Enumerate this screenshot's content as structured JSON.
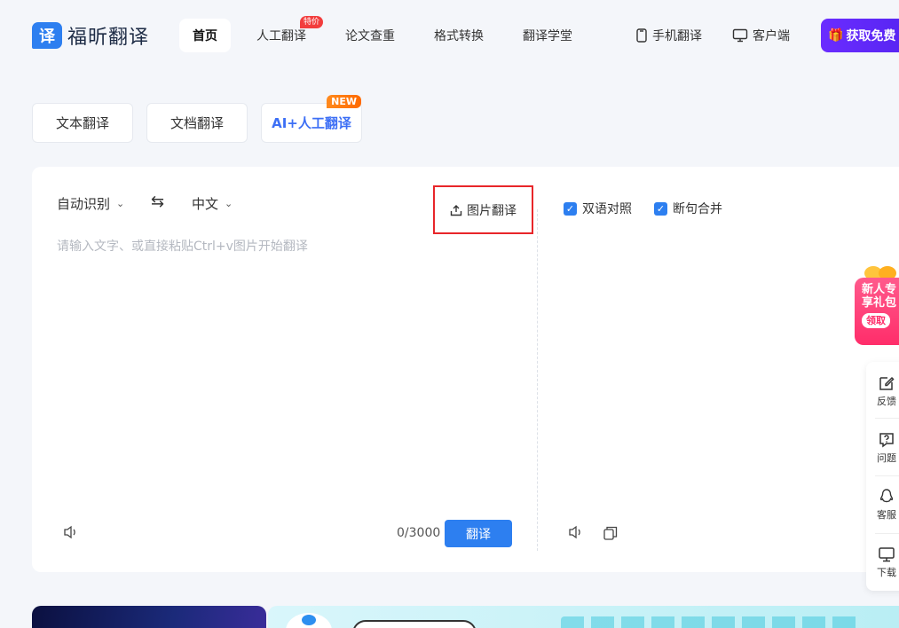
{
  "brand": {
    "name": "福昕翻译",
    "logo_char": "译"
  },
  "nav": {
    "items": [
      {
        "label": "首页",
        "active": true
      },
      {
        "label": "人工翻译",
        "badge": "特价"
      },
      {
        "label": "论文查重"
      },
      {
        "label": "格式转换"
      },
      {
        "label": "翻译学堂"
      }
    ]
  },
  "header_right": {
    "mobile": "手机翻译",
    "desktop": "客户端",
    "cta": "获取免费"
  },
  "mode_tabs": [
    {
      "label": "文本翻译"
    },
    {
      "label": "文档翻译"
    },
    {
      "label": "AI+人工翻译",
      "badge": "NEW"
    }
  ],
  "translator": {
    "source_lang": "自动识别",
    "target_lang": "中文",
    "image_translate": "图片翻译",
    "placeholder": "请输入文字、或直接粘贴Ctrl+v图片开始翻译",
    "counter": "0/3000",
    "translate_button": "翻译",
    "options": [
      {
        "label": "双语对照",
        "checked": true
      },
      {
        "label": "断句合并",
        "checked": true
      }
    ]
  },
  "promo": {
    "line1": "新人专",
    "line2": "享礼包",
    "claim": "领取"
  },
  "side_bar": [
    {
      "label": "反馈",
      "icon": "edit-icon"
    },
    {
      "label": "问题",
      "icon": "question-icon"
    },
    {
      "label": "客服",
      "icon": "qq-icon"
    },
    {
      "label": "下载",
      "icon": "monitor-icon"
    }
  ],
  "colors": {
    "primary": "#2d7ff0",
    "cta": "#5524f0",
    "highlight_box": "#e8262a"
  }
}
